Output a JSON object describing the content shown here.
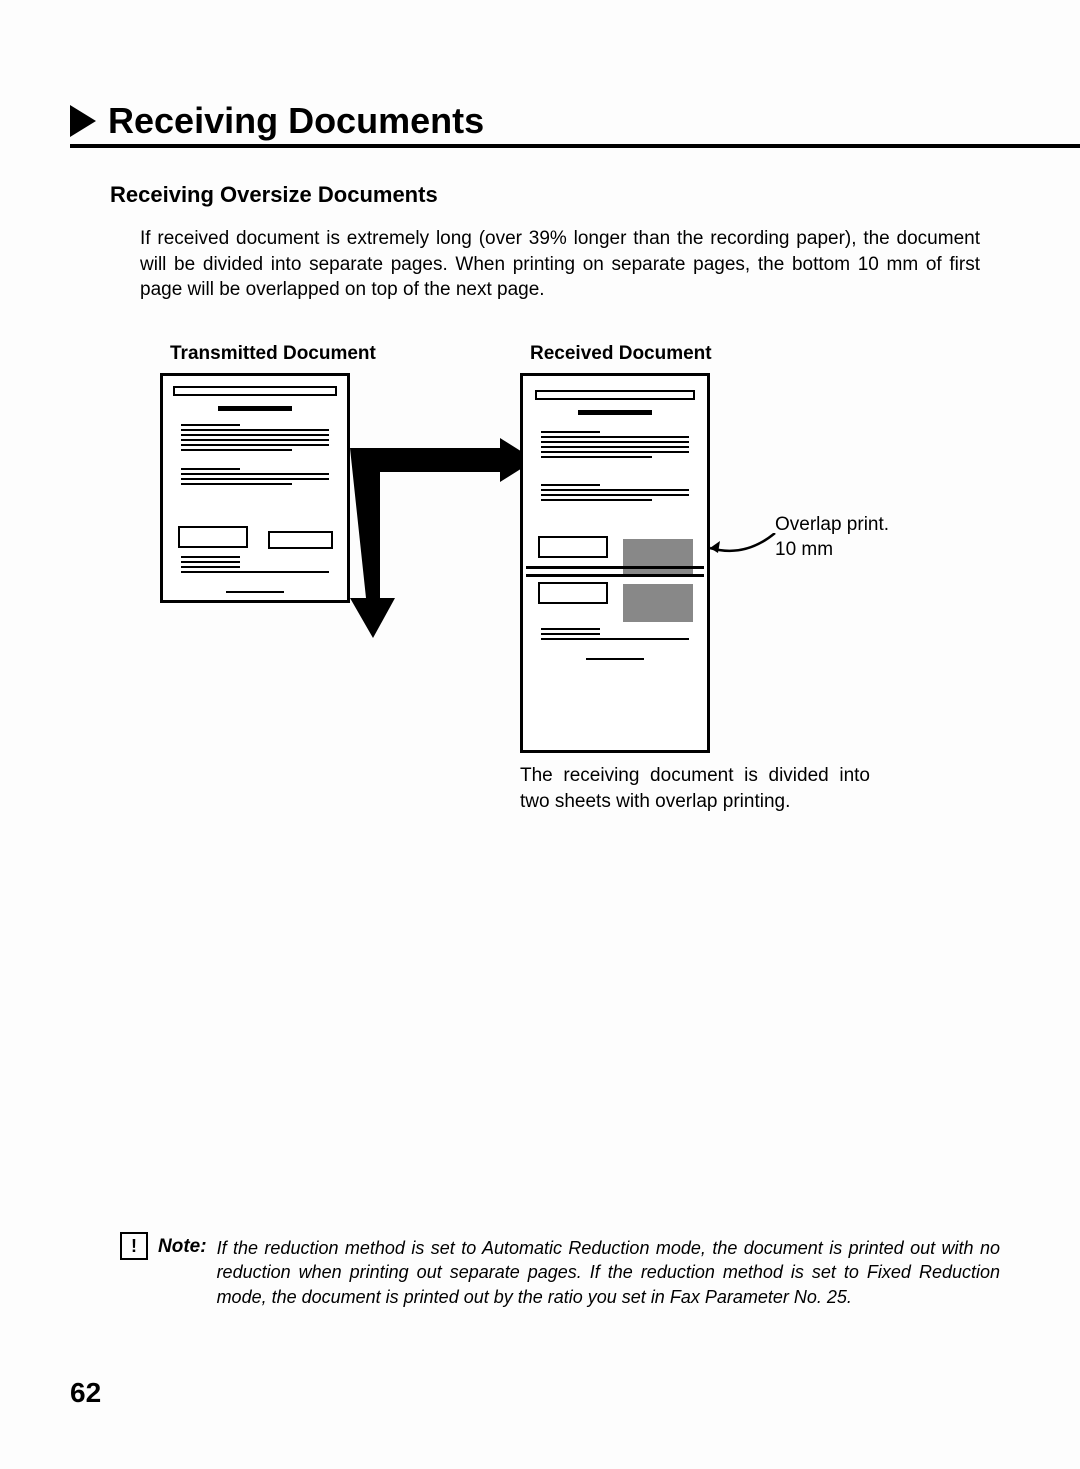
{
  "title": "Receiving Documents",
  "section": "Receiving Oversize Documents",
  "paragraph": "If received document is extremely long (over 39% longer than the recording paper), the document will be divided into separate pages. When printing on separate pages, the bottom 10 mm of first page will be overlapped on top of the next page.",
  "transmitted_label": "Transmitted Document",
  "received_label": "Received Document",
  "overlap_annot_line1": "Overlap print.",
  "overlap_annot_line2": "10 mm",
  "caption": "The receiving document is divided into two sheets with overlap printing.",
  "note_symbol": "!",
  "note_label": "Note:",
  "note_text": "If the reduction method is set to Automatic Reduction mode, the document is printed out with no reduction when printing out separate pages. If the reduction method is set to Fixed Reduction mode, the document is printed out by the ratio you set in Fax Parameter No. 25.",
  "page_number": "62"
}
